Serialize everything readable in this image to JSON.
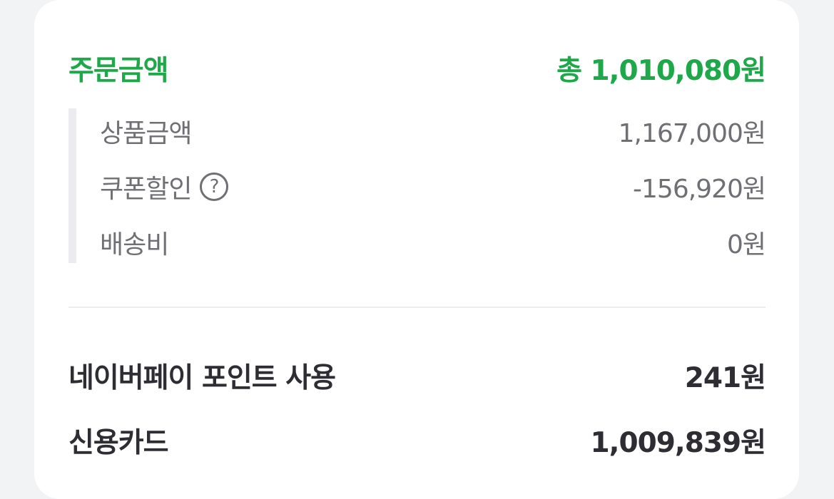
{
  "order_summary": {
    "title": "주문금액",
    "total": "총 1,010,080원"
  },
  "breakdown": [
    {
      "label": "상품금액",
      "value": "1,167,000원"
    },
    {
      "label": "쿠폰할인",
      "value": "-156,920원",
      "has_help_icon": true
    },
    {
      "label": "배송비",
      "value": "0원"
    }
  ],
  "help_icon_glyph": "?",
  "payments": [
    {
      "label": "네이버페이 포인트 사용",
      "value": "241원"
    },
    {
      "label": "신용카드",
      "value": "1,009,839원"
    }
  ],
  "colors": {
    "accent_green": "#1fa84a",
    "text_dark": "#2d2d33",
    "text_muted": "#6f6f74",
    "background": "#f2f3f5"
  }
}
